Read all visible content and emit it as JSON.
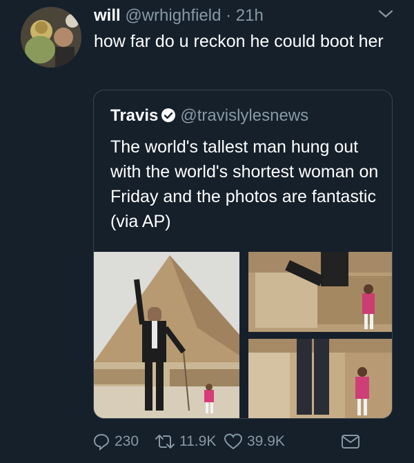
{
  "tweet": {
    "display_name": "will",
    "handle": "@wrhighfield",
    "separator": " · ",
    "time": "21h",
    "text": "how far do u reckon he could boot her"
  },
  "quoted": {
    "display_name": "Travis",
    "verified": true,
    "handle": "@travislylesnews",
    "text": "The world's tallest man hung out with the world's shortest woman on Friday and the photos are fantastic (via AP)"
  },
  "actions": {
    "replies": "230",
    "retweets": "11.9K",
    "likes": "39.9K"
  },
  "colors": {
    "background": "#15202b",
    "secondary_text": "#8899a6",
    "border": "#38444d",
    "verified_badge": "#ffffff"
  },
  "icons": [
    "chevron-down-icon",
    "verified-icon",
    "reply-icon",
    "retweet-icon",
    "like-icon",
    "message-icon"
  ]
}
